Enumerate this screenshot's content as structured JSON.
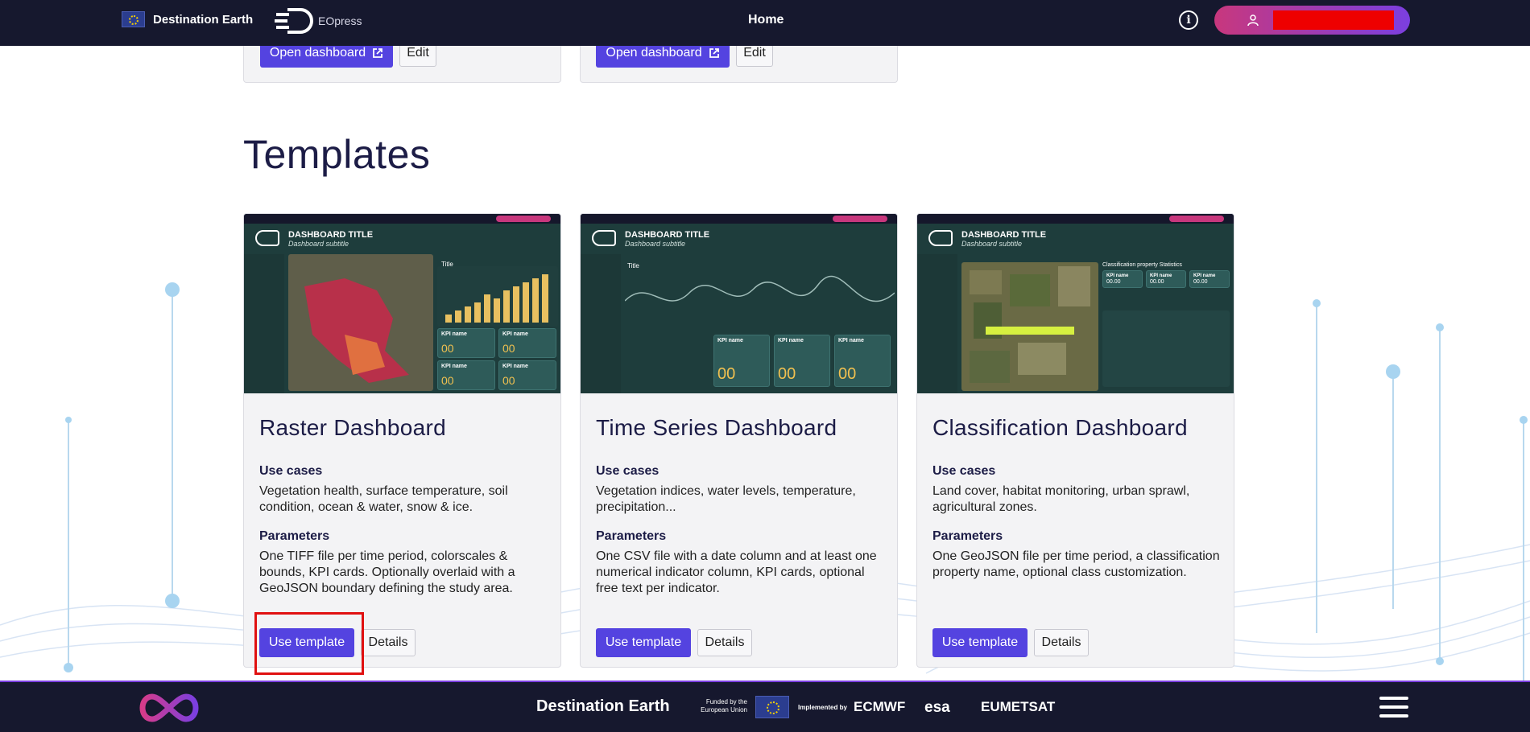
{
  "navbar": {
    "brand": "Destination Earth",
    "product": "EOpress",
    "home": "Home",
    "info_icon": "i"
  },
  "top_cards": [
    {
      "open_label": "Open dashboard",
      "edit_label": "Edit"
    },
    {
      "open_label": "Open dashboard",
      "edit_label": "Edit"
    }
  ],
  "section_title": "Templates",
  "templates": [
    {
      "title": "Raster Dashboard",
      "use_cases_label": "Use cases",
      "use_cases": "Vegetation health, surface temperature, soil condition, ocean & water, snow & ice.",
      "parameters_label": "Parameters",
      "parameters": "One TIFF file per time period, colorscales & bounds, KPI cards. Optionally overlaid with a GeoJSON boundary defining the study area.",
      "use_label": "Use template",
      "details_label": "Details",
      "thumb": {
        "title": "DASHBOARD TITLE",
        "subtitle": "Dashboard subtitle",
        "chart_title": "Title",
        "kpi": "KPI name",
        "kpi_value": "00"
      }
    },
    {
      "title": "Time Series Dashboard",
      "use_cases_label": "Use cases",
      "use_cases": "Vegetation indices, water levels, temperature, precipitation...",
      "parameters_label": "Parameters",
      "parameters": "One CSV file with a date column and at least one numerical indicator column, KPI cards, optional free text per indicator.",
      "use_label": "Use template",
      "details_label": "Details",
      "thumb": {
        "title": "DASHBOARD TITLE",
        "subtitle": "Dashboard subtitle",
        "chart_title": "Title",
        "kpi": "KPI name",
        "kpi_value": "00"
      }
    },
    {
      "title": "Classification Dashboard",
      "use_cases_label": "Use cases",
      "use_cases": "Land cover, habitat monitoring, urban sprawl, agricultural zones.",
      "parameters_label": "Parameters",
      "parameters": "One GeoJSON file per time period, a classification property name, optional class customization.",
      "use_label": "Use template",
      "details_label": "Details",
      "thumb": {
        "title": "DASHBOARD TITLE",
        "subtitle": "Dashboard subtitle",
        "chart_title": "Classification property Statistics",
        "kpi": "KPI name",
        "kpi_value": "00.00"
      }
    }
  ],
  "footer": {
    "brand": "Destination Earth",
    "funded": "Funded by the European Union",
    "implemented": "Implemented by",
    "orgs": [
      "ECMWF",
      "esa",
      "EUMETSAT"
    ]
  },
  "colors": {
    "navbar": "#16182e",
    "primary": "#5443e0",
    "highlight": "#e01010"
  }
}
